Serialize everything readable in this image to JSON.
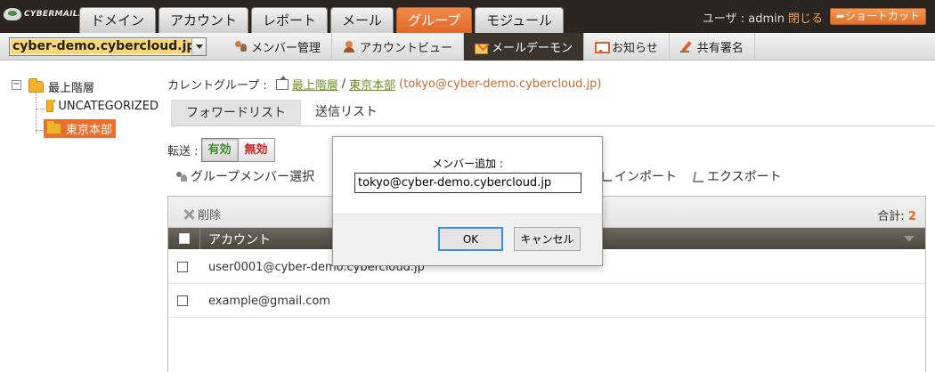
{
  "brand": {
    "name": "CYBERMAILΣ"
  },
  "tabs": [
    {
      "label": "ドメイン"
    },
    {
      "label": "アカウント"
    },
    {
      "label": "レポート"
    },
    {
      "label": "メール"
    },
    {
      "label": "グループ"
    },
    {
      "label": "モジュール"
    }
  ],
  "user": {
    "label": "ユーザ : admin",
    "logout": "閉じる"
  },
  "shortcut": {
    "label": "ショートカット"
  },
  "domain_select": {
    "value": "cyber-demo.cybercloud.jp"
  },
  "subtabs": [
    {
      "label": "メンバー管理"
    },
    {
      "label": "アカウントビュー"
    },
    {
      "label": "メールデーモン"
    },
    {
      "label": "お知らせ"
    },
    {
      "label": "共有署名"
    }
  ],
  "tree": {
    "toggle": "−",
    "root": "最上階層",
    "children": [
      {
        "label": "UNCATEGORIZED"
      },
      {
        "label": "東京本部"
      }
    ]
  },
  "breadcrumb": {
    "prefix": "カレントグループ :",
    "root": "最上階層",
    "sep": "/",
    "current": "東京本部",
    "email": "(tokyo@cyber-demo.cybercloud.jp)"
  },
  "content_tabs": [
    {
      "label": "フォワードリスト"
    },
    {
      "label": "送信リスト"
    }
  ],
  "transfer": {
    "label": "転送 :",
    "on": "有効",
    "off": "無効"
  },
  "toolbar": {
    "select_members": "グループメンバー選択",
    "import": "インポート",
    "export": "エクスポート"
  },
  "grid": {
    "delete": "削除",
    "total_label": "合計:",
    "total": "2",
    "column": "アカウント",
    "rows": [
      {
        "account": "user0001@cyber-demo.cybercloud.jp"
      },
      {
        "account": "example@gmail.com"
      }
    ]
  },
  "dialog": {
    "message": "メンバー追加 :",
    "input_value": "tokyo@cyber-demo.cybercloud.jp",
    "ok": "OK",
    "cancel": "キャンセル"
  }
}
